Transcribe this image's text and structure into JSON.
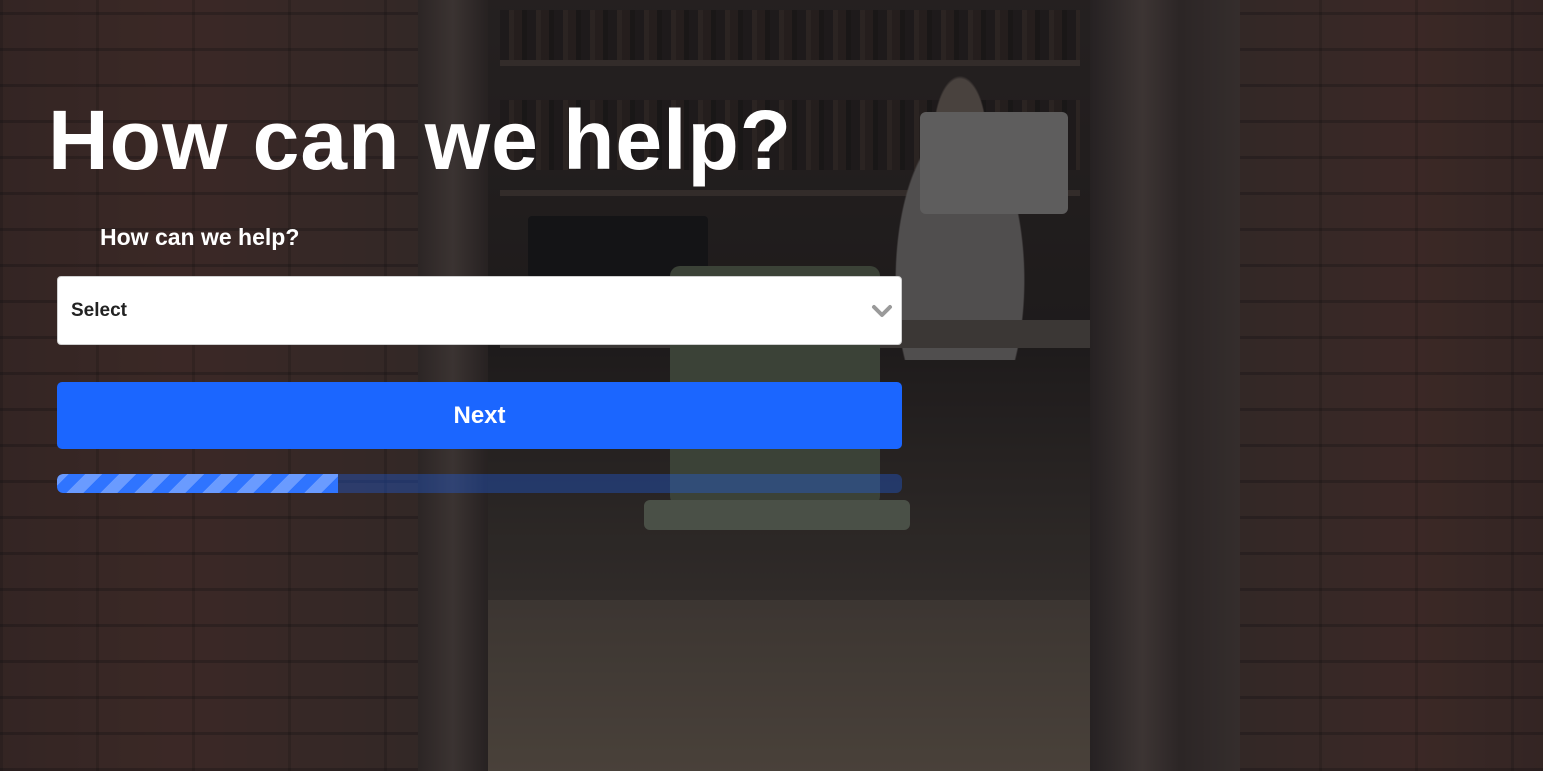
{
  "hero": {
    "title": "How can we help?"
  },
  "form": {
    "label": "How can we help?",
    "select": {
      "selected": "Select",
      "icon": "chevron-down-icon"
    },
    "next_label": "Next",
    "progress": {
      "fraction": 0.333
    }
  },
  "colors": {
    "accent": "#1b66ff",
    "progress_track": "#1b66ff52",
    "overlay": "#141418"
  }
}
